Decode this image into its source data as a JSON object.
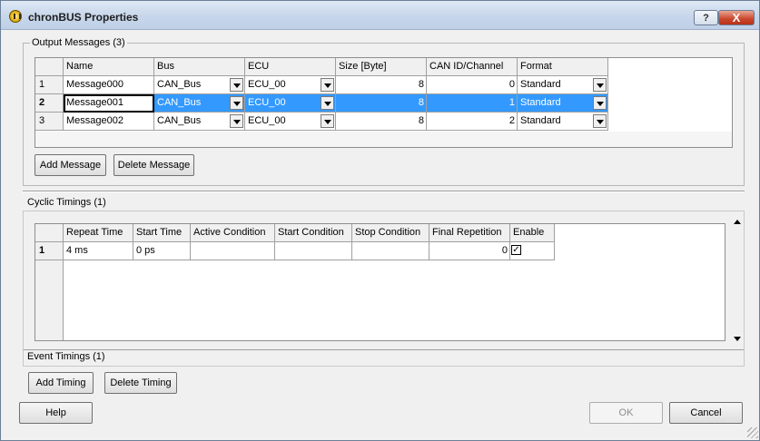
{
  "window": {
    "title": "chronBUS Properties",
    "help_glyph": "?",
    "close_glyph": "X"
  },
  "output_messages": {
    "label": "Output Messages (3)",
    "columns": [
      "Name",
      "Bus",
      "ECU",
      "Size [Byte]",
      "CAN ID/Channel",
      "Format"
    ],
    "rows": [
      {
        "index": "1",
        "name": "Message000",
        "bus": "CAN_Bus",
        "ecu": "ECU_00",
        "size": "8",
        "can_id": "0",
        "format": "Standard"
      },
      {
        "index": "2",
        "name": "Message001",
        "bus": "CAN_Bus",
        "ecu": "ECU_00",
        "size": "8",
        "can_id": "1",
        "format": "Standard"
      },
      {
        "index": "3",
        "name": "Message002",
        "bus": "CAN_Bus",
        "ecu": "ECU_00",
        "size": "8",
        "can_id": "2",
        "format": "Standard"
      }
    ],
    "add_label": "Add Message",
    "delete_label": "Delete Message"
  },
  "cyclic_timings": {
    "label": "Cyclic Timings (1)",
    "columns": [
      "Repeat Time",
      "Start Time",
      "Active Condition",
      "Start Condition",
      "Stop Condition",
      "Final Repetition",
      "Enable"
    ],
    "rows": [
      {
        "index": "1",
        "repeat_time": "4 ms",
        "start_time": "0 ps",
        "active_condition": "",
        "start_condition": "",
        "stop_condition": "",
        "final_repetition": "0",
        "enable_mark": "✓"
      }
    ]
  },
  "event_timings": {
    "label": "Event Timings (1)"
  },
  "buttons": {
    "add_timing": "Add Timing",
    "delete_timing": "Delete Timing",
    "help": "Help",
    "ok": "OK",
    "cancel": "Cancel"
  }
}
